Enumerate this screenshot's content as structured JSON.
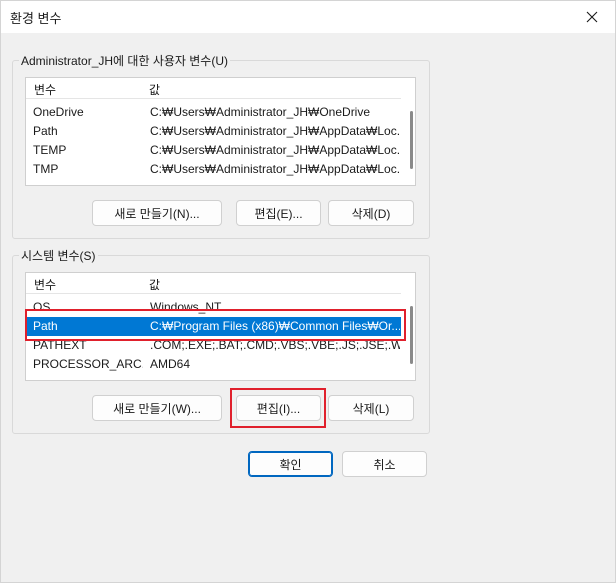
{
  "window": {
    "title": "환경 변수"
  },
  "user_vars": {
    "group_label": "Administrator_JH에 대한 사용자 변수(U)",
    "columns": [
      "변수",
      "값"
    ],
    "rows": [
      {
        "name": "OneDrive",
        "value": "C:₩Users₩Administrator_JH₩OneDrive"
      },
      {
        "name": "Path",
        "value": "C:₩Users₩Administrator_JH₩AppData₩Loc..."
      },
      {
        "name": "TEMP",
        "value": "C:₩Users₩Administrator_JH₩AppData₩Loc..."
      },
      {
        "name": "TMP",
        "value": "C:₩Users₩Administrator_JH₩AppData₩Loc..."
      }
    ],
    "buttons": {
      "new": "새로 만들기(N)...",
      "edit": "편집(E)...",
      "delete": "삭제(D)"
    }
  },
  "system_vars": {
    "group_label": "시스템 변수(S)",
    "columns": [
      "변수",
      "값"
    ],
    "rows": [
      {
        "name": "OS",
        "value": "Windows_NT"
      },
      {
        "name": "Path",
        "value": "C:₩Program Files (x86)₩Common Files₩Or...",
        "selected": true
      },
      {
        "name": "PATHEXT",
        "value": ".COM;.EXE;.BAT;.CMD;.VBS;.VBE;.JS;.JSE;.W..."
      },
      {
        "name": "PROCESSOR_ARC...",
        "value": "AMD64"
      }
    ],
    "buttons": {
      "new": "새로 만들기(W)...",
      "edit": "편집(I)...",
      "delete": "삭제(L)"
    }
  },
  "footer": {
    "ok": "확인",
    "cancel": "취소"
  },
  "colors": {
    "selection": "#0078d4",
    "highlight_box": "#e0202c",
    "primary_border": "#0067c0"
  }
}
